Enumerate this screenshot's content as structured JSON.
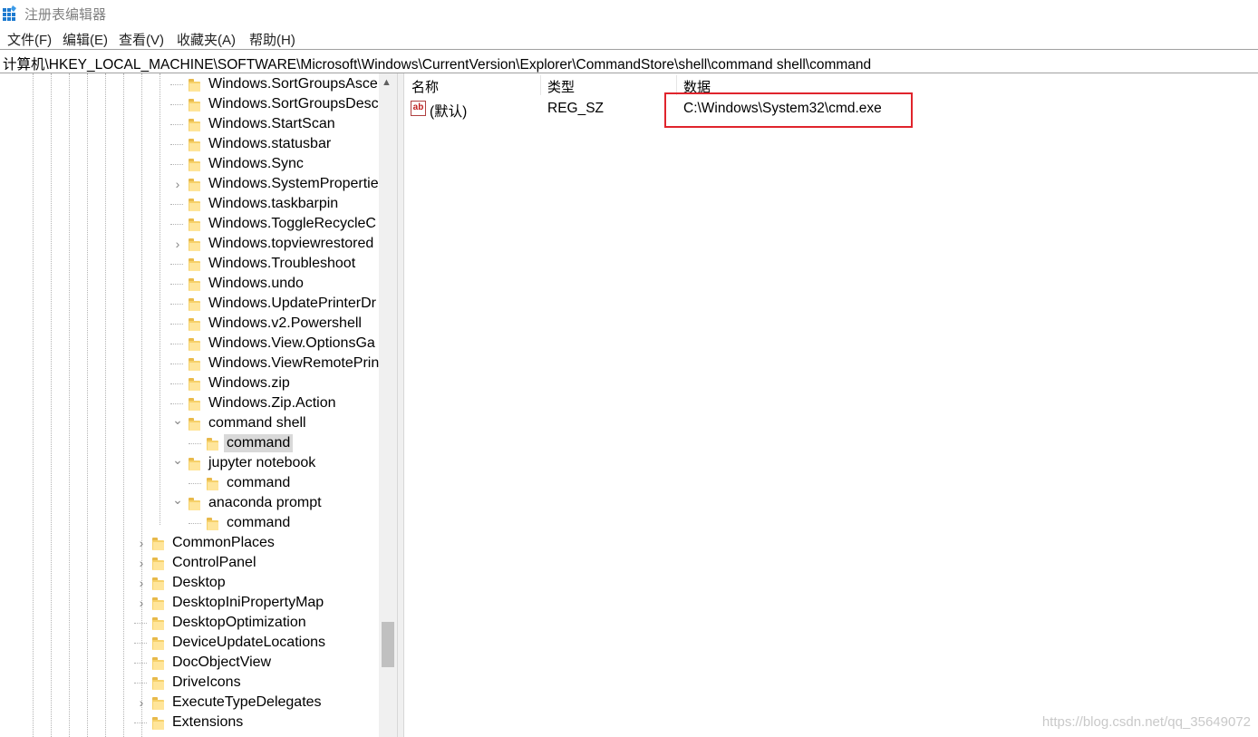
{
  "window": {
    "title": "注册表编辑器"
  },
  "menu": [
    "文件(F)",
    "编辑(E)",
    "查看(V)",
    "收藏夹(A)",
    "帮助(H)"
  ],
  "address": "计算机\\HKEY_LOCAL_MACHINE\\SOFTWARE\\Microsoft\\Windows\\CurrentVersion\\Explorer\\CommandStore\\shell\\command shell\\command",
  "tree": [
    {
      "label": "Windows.SortGroupsAsce",
      "chev": ""
    },
    {
      "label": "Windows.SortGroupsDesc",
      "chev": ""
    },
    {
      "label": "Windows.StartScan",
      "chev": ""
    },
    {
      "label": "Windows.statusbar",
      "chev": ""
    },
    {
      "label": "Windows.Sync",
      "chev": ""
    },
    {
      "label": "Windows.SystemProperties",
      "chev": "›"
    },
    {
      "label": "Windows.taskbarpin",
      "chev": ""
    },
    {
      "label": "Windows.ToggleRecycleC",
      "chev": ""
    },
    {
      "label": "Windows.topviewrestored",
      "chev": "›"
    },
    {
      "label": "Windows.Troubleshoot",
      "chev": ""
    },
    {
      "label": "Windows.undo",
      "chev": ""
    },
    {
      "label": "Windows.UpdatePrinterDr",
      "chev": ""
    },
    {
      "label": "Windows.v2.Powershell",
      "chev": ""
    },
    {
      "label": "Windows.View.OptionsGa",
      "chev": ""
    },
    {
      "label": "Windows.ViewRemotePrin",
      "chev": ""
    },
    {
      "label": "Windows.zip",
      "chev": ""
    },
    {
      "label": "Windows.Zip.Action",
      "chev": ""
    },
    {
      "label": "command shell",
      "chev": "⌄"
    },
    {
      "label": "command",
      "chev": ""
    },
    {
      "label": "jupyter notebook",
      "chev": "⌄"
    },
    {
      "label": "command",
      "chev": ""
    },
    {
      "label": "anaconda prompt",
      "chev": "⌄"
    },
    {
      "label": "command",
      "chev": ""
    },
    {
      "label": "CommonPlaces",
      "chev": "›"
    },
    {
      "label": "ControlPanel",
      "chev": "›"
    },
    {
      "label": "Desktop",
      "chev": "›"
    },
    {
      "label": "DesktopIniPropertyMap",
      "chev": "›"
    },
    {
      "label": "DesktopOptimization",
      "chev": ""
    },
    {
      "label": "DeviceUpdateLocations",
      "chev": ""
    },
    {
      "label": "DocObjectView",
      "chev": ""
    },
    {
      "label": "DriveIcons",
      "chev": ""
    },
    {
      "label": "ExecuteTypeDelegates",
      "chev": "›"
    },
    {
      "label": "Extensions",
      "chev": ""
    }
  ],
  "columns": {
    "name": "名称",
    "type": "类型",
    "data": "数据"
  },
  "value_row": {
    "name": "(默认)",
    "type": "REG_SZ",
    "data": "C:\\Windows\\System32\\cmd.exe",
    "icon": "ab"
  },
  "watermark": "https://blog.csdn.net/qq_35649072",
  "colors": {
    "highlight": "#e0242c",
    "folder": "#f6d16a",
    "selection": "#d9d9d9"
  }
}
